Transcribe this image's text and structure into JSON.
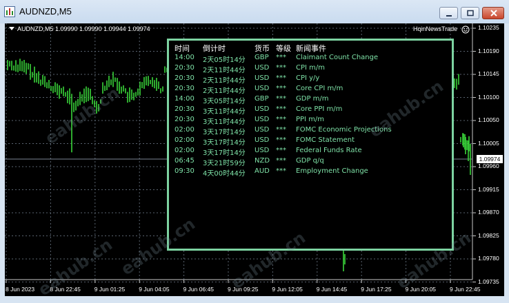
{
  "window": {
    "title": "AUDNZD,M5"
  },
  "chart": {
    "symbol_line": "AUDNZD,M5  1.09990 1.09990 1.09944 1.09974",
    "brand": "HqinNewsTrade",
    "current_price": "1.09974",
    "colors": {
      "candle": "#39d639",
      "panel_border": "#7dd3a1",
      "row_text": "#7fe3a8",
      "grid": "#5a6470"
    },
    "price_axis": [
      "1.10235",
      "1.10190",
      "1.10145",
      "1.10100",
      "1.10050",
      "1.10005",
      "1.09960",
      "1.09915",
      "1.09870",
      "1.09825",
      "1.09780",
      "1.09735"
    ],
    "time_axis": [
      "8 Jun 2023",
      "8 Jun 22:45",
      "9 Jun 01:25",
      "9 Jun 04:05",
      "9 Jun 06:45",
      "9 Jun 09:25",
      "9 Jun 12:05",
      "9 Jun 14:45",
      "9 Jun 17:25",
      "9 Jun 20:05",
      "9 Jun 22:45"
    ]
  },
  "news": {
    "headers": {
      "time": "时间",
      "countdown": "倒计时",
      "currency": "货币",
      "level": "等级",
      "event": "新闻事件"
    },
    "rows": [
      {
        "time": "14:00",
        "countdown": "2天05时14分",
        "currency": "GBP",
        "level": "***",
        "event": "Claimant Count Change"
      },
      {
        "time": "20:30",
        "countdown": "2天11时44分",
        "currency": "USD",
        "level": "***",
        "event": "CPI m/m"
      },
      {
        "time": "20:30",
        "countdown": "2天11时44分",
        "currency": "USD",
        "level": "***",
        "event": "CPI y/y"
      },
      {
        "time": "20:30",
        "countdown": "2天11时44分",
        "currency": "USD",
        "level": "***",
        "event": "Core CPI m/m"
      },
      {
        "time": "14:00",
        "countdown": "3天05时14分",
        "currency": "GBP",
        "level": "***",
        "event": "GDP m/m"
      },
      {
        "time": "20:30",
        "countdown": "3天11时44分",
        "currency": "USD",
        "level": "***",
        "event": "Core PPI m/m"
      },
      {
        "time": "20:30",
        "countdown": "3天11时44分",
        "currency": "USD",
        "level": "***",
        "event": "PPI m/m"
      },
      {
        "time": "02:00",
        "countdown": "3天17时14分",
        "currency": "USD",
        "level": "***",
        "event": "FOMC Economic Projections"
      },
      {
        "time": "02:00",
        "countdown": "3天17时14分",
        "currency": "USD",
        "level": "***",
        "event": "FOMC Statement"
      },
      {
        "time": "02:00",
        "countdown": "3天17时14分",
        "currency": "USD",
        "level": "***",
        "event": "Federal Funds Rate"
      },
      {
        "time": "06:45",
        "countdown": "3天21时59分",
        "currency": "NZD",
        "level": "***",
        "event": "GDP q/q"
      },
      {
        "time": "09:30",
        "countdown": "4天00时44分",
        "currency": "AUD",
        "level": "***",
        "event": "Employment Change"
      }
    ]
  },
  "watermark": "eahub.cn"
}
